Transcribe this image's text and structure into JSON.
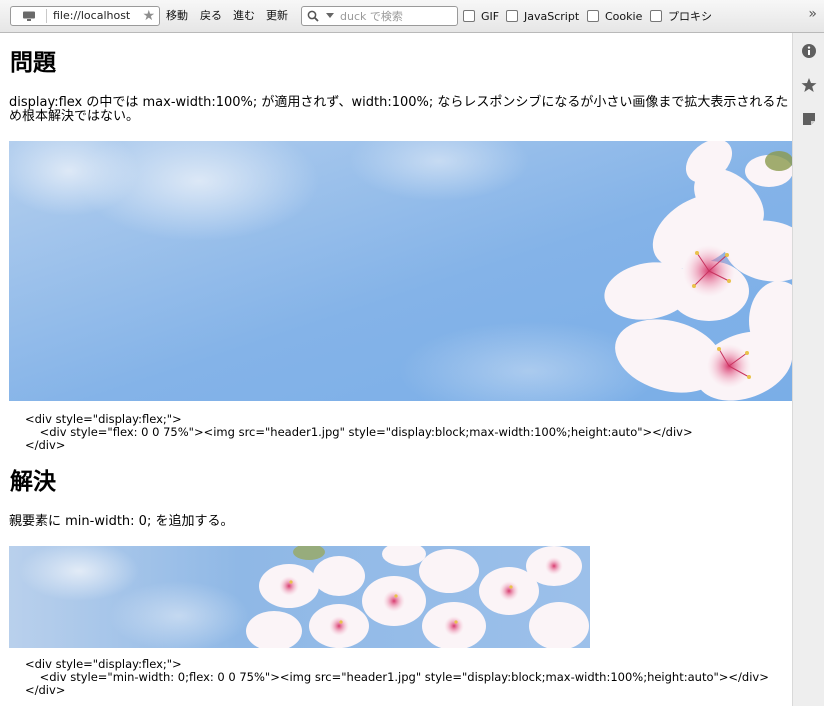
{
  "toolbar": {
    "url": "file://localhost",
    "buttons": {
      "move": "移動",
      "back": "戻る",
      "forward": "進む",
      "reload": "更新"
    },
    "search": {
      "placeholder": "duck で検索",
      "value": ""
    },
    "checkboxes": [
      {
        "label": "GIF",
        "checked": false
      },
      {
        "label": "JavaScript",
        "checked": false
      },
      {
        "label": "Cookie",
        "checked": false
      },
      {
        "label": "プロキシ",
        "checked": false
      }
    ],
    "overflow": "»"
  },
  "sidebar": {
    "icons": [
      "info-icon",
      "bookmark-star-icon",
      "note-icon"
    ]
  },
  "page": {
    "problem": {
      "heading": "問題",
      "text": "display:flex の中では max-width:100%; が適用されず、width:100%; ならレスポンシブになるが小さい画像まで拡大表示されるため根本解決ではない。",
      "code": [
        "<div style=\"display:flex;\">",
        "    <div style=\"flex: 0 0 75%\"><img src=\"header1.jpg\" style=\"display:block;max-width:100%;height:auto\"></div>",
        "</div>"
      ]
    },
    "solution": {
      "heading": "解決",
      "text": "親要素に min-width: 0; を追加する。",
      "code": [
        "<div style=\"display:flex;\">",
        "    <div style=\"min-width: 0;flex: 0 0 75%\"><img src=\"header1.jpg\" style=\"display:block;max-width:100%;height:auto\"></div>",
        "</div>"
      ]
    }
  },
  "colors": {
    "sky": "#86b6ea",
    "blossom": "#fbf4f7",
    "blossom_center": "#e0507e"
  }
}
